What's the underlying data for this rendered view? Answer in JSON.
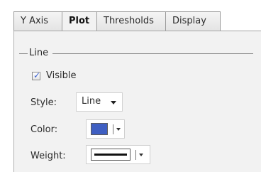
{
  "tabs": [
    {
      "label": "Y Axis",
      "selected": false
    },
    {
      "label": "Plot",
      "selected": true
    },
    {
      "label": "Thresholds",
      "selected": false
    },
    {
      "label": "Display",
      "selected": false
    }
  ],
  "line_group": {
    "title": "Line",
    "visible": {
      "label": "Visible",
      "checked": true
    },
    "style": {
      "label": "Style:",
      "value": "Line"
    },
    "color": {
      "label": "Color:",
      "swatch": "#3f5fc2"
    },
    "weight": {
      "label": "Weight:"
    }
  },
  "icons": {
    "checkbox": "check-icon",
    "dropdown": "chevron-down-icon"
  }
}
